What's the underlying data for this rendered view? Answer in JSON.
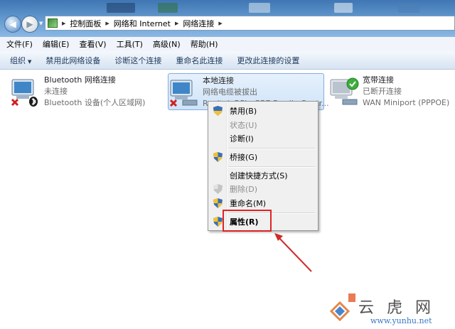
{
  "address": {
    "crumbs": [
      "控制面板",
      "网络和 Internet",
      "网络连接"
    ]
  },
  "menubar": [
    "文件(F)",
    "编辑(E)",
    "查看(V)",
    "工具(T)",
    "高级(N)",
    "帮助(H)"
  ],
  "toolbar": {
    "organize": "组织",
    "items": [
      "禁用此网络设备",
      "诊断这个连接",
      "重命名此连接",
      "更改此连接的设置"
    ]
  },
  "connections": [
    {
      "name": "Bluetooth 网络连接",
      "status": "未连接",
      "device": "Bluetooth 设备(个人区域网)"
    },
    {
      "name": "本地连接",
      "status": "网络电缆被拔出",
      "device": "Realtek PCIe GBE Family Contr..."
    },
    {
      "name": "宽带连接",
      "status": "已断开连接",
      "device": "WAN Miniport (PPPOE)"
    }
  ],
  "context_menu": [
    {
      "label": "禁用(B)",
      "enabled": true
    },
    {
      "label": "状态(U)",
      "enabled": false
    },
    {
      "label": "诊断(I)",
      "enabled": true
    },
    {
      "label": "桥接(G)",
      "enabled": true
    },
    {
      "label": "创建快捷方式(S)",
      "enabled": true
    },
    {
      "label": "删除(D)",
      "enabled": false
    },
    {
      "label": "重命名(M)",
      "enabled": true
    },
    {
      "label": "属性(R)",
      "enabled": true,
      "bold": true
    }
  ],
  "watermark": {
    "url": "www.yunhu.net"
  },
  "colors": {
    "annotation": "#e02323",
    "window_top": "#3f76b3",
    "selection": "#cfe4f9"
  }
}
